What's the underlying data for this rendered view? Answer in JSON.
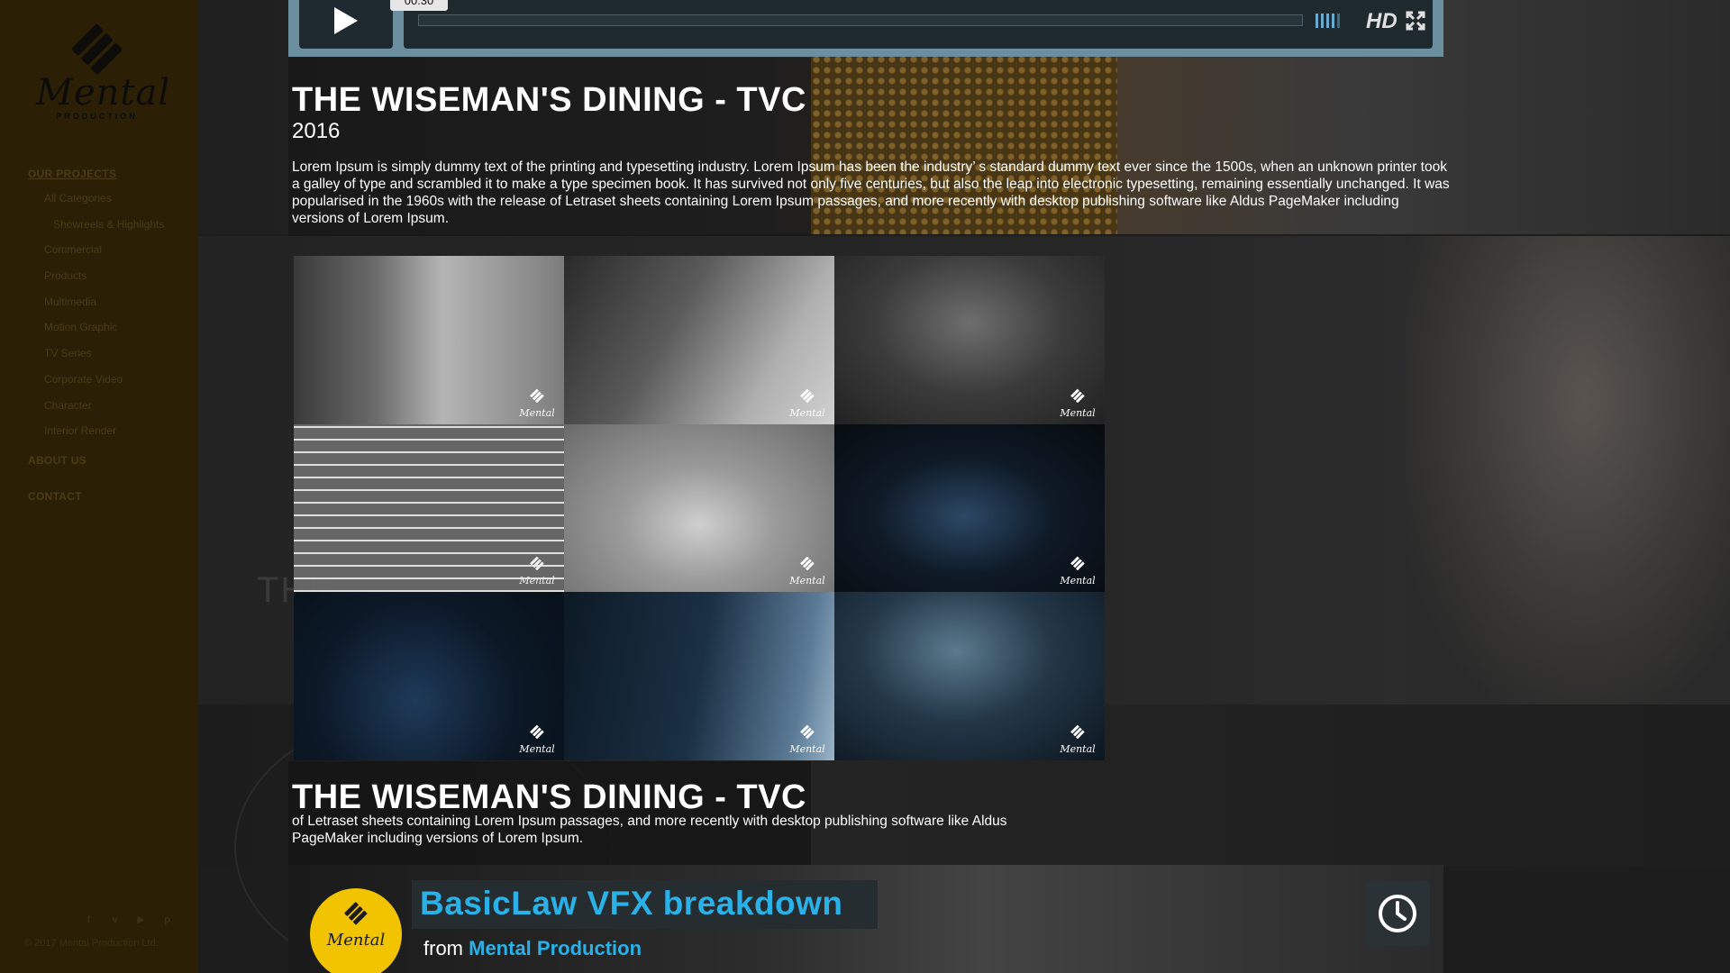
{
  "sidebar": {
    "brand": "Mental",
    "brand_sub": "PRODUCTION",
    "nav_heading": "OUR PROJECTS",
    "categories": [
      {
        "label": "All Categories",
        "deep": false
      },
      {
        "label": "Showreels & Highlights",
        "deep": true
      },
      {
        "label": "Commercial",
        "deep": false
      },
      {
        "label": "Products",
        "deep": false
      },
      {
        "label": "Multimedia",
        "deep": false
      },
      {
        "label": "Motion Graphic",
        "deep": false
      },
      {
        "label": "TV Series",
        "deep": false
      },
      {
        "label": "Corporate Video",
        "deep": false
      },
      {
        "label": "Character",
        "deep": false
      },
      {
        "label": "Interior Render",
        "deep": false
      }
    ],
    "about": "ABOUT US",
    "contact": "CONTACT",
    "social": [
      {
        "icon": "facebook-icon",
        "glyph": "f"
      },
      {
        "icon": "vimeo-icon",
        "glyph": "v"
      },
      {
        "icon": "youtube-icon",
        "glyph": "▶"
      },
      {
        "icon": "pinterest-icon",
        "glyph": "p"
      }
    ],
    "copyright": "© 2017 Mental Production Ltd."
  },
  "player": {
    "time": "00:30",
    "hd_label": "HD"
  },
  "project": {
    "title": "THE WISEMAN'S DINING - TVC",
    "year": "2016",
    "description": "Lorem Ipsum is simply dummy text of the printing and typesetting industry. Lorem Ipsum has been the industry’ s standard dummy text ever since the 1500s, when an unknown printer took a galley of type and scrambled it to make a type specimen book. It has survived not only five centuries, but also the leap into electronic typesetting, remaining essentially unchanged. It was popularised in the 1960s with the release of Letraset sheets containing Lorem Ipsum passages, and more recently with desktop publishing software like Aldus PageMaker including versions of Lorem Ipsum."
  },
  "background_title": "THE",
  "gallery": {
    "watermark": "Mental",
    "count": 9
  },
  "project2": {
    "title": "THE WISEMAN'S DINING - TVC",
    "description": "of Letraset sheets containing Lorem Ipsum passages, and more recently with desktop publishing software like Aldus PageMaker including versions of Lorem Ipsum."
  },
  "video2": {
    "title": "BasicLaw VFX breakdown",
    "from_prefix": "from",
    "channel": "Mental Production",
    "avatar_word": "Mental"
  },
  "colors": {
    "sidebar_bg": "#2b2005",
    "accent_blue": "#2ab1e8",
    "avatar_yellow": "#f2c400"
  }
}
